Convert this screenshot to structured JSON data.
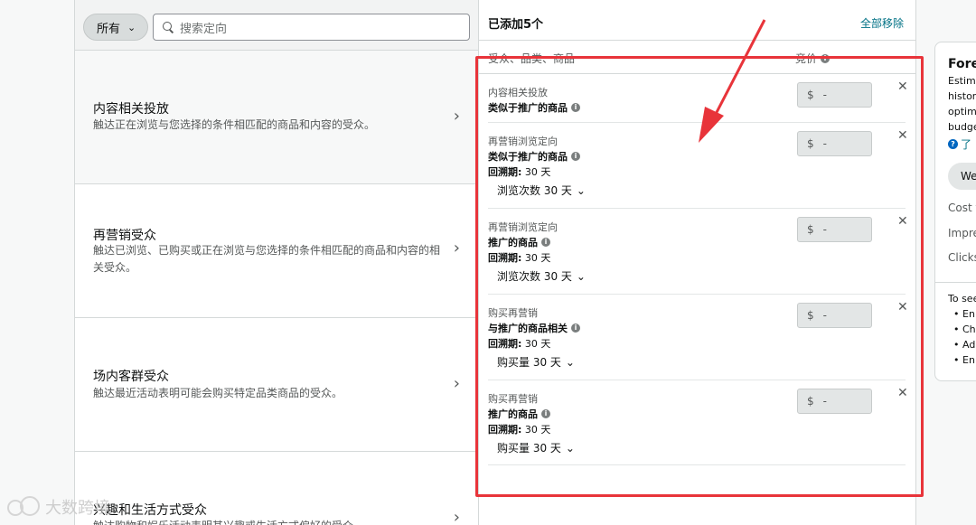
{
  "left": {
    "filter_label": "所有",
    "search_placeholder": "搜索定向",
    "categories": [
      {
        "title": "内容相关投放",
        "desc": "触达正在浏览与您选择的条件相匹配的商品和内容的受众。"
      },
      {
        "title": "再营销受众",
        "desc": "触达已浏览、已购买或正在浏览与您选择的条件相匹配的商品和内容的相关受众。"
      },
      {
        "title": "场内客群受众",
        "desc": "触达最近活动表明可能会购买特定品类商品的受众。"
      },
      {
        "title": "兴趣和生活方式受众",
        "desc": "触达购物和娱乐活动表明其兴趣或生活方式偏好的受众。"
      }
    ]
  },
  "center": {
    "added_title": "已添加5个",
    "remove_all": "全部移除",
    "col_targeting": "受众、品类、商品",
    "col_bid": "竞价",
    "currency": "$",
    "bid_placeholder": "-",
    "lookback_label": "回溯期:",
    "rows": [
      {
        "type": "内容相关投放",
        "target": "类似于推广的商品",
        "lookback": "",
        "dropdown": ""
      },
      {
        "type": "再营销浏览定向",
        "target": "类似于推广的商品",
        "lookback": "30 天",
        "dropdown": "浏览次数 30 天"
      },
      {
        "type": "再营销浏览定向",
        "target": "推广的商品",
        "lookback": "30 天",
        "dropdown": "浏览次数 30 天"
      },
      {
        "type": "购买再营销",
        "target": "与推广的商品相关",
        "lookback": "30 天",
        "dropdown": "购买量 30 天"
      },
      {
        "type": "购买再营销",
        "target": "推广的商品",
        "lookback": "30 天",
        "dropdown": "购买量 30 天"
      }
    ]
  },
  "right": {
    "title": "Fore",
    "est_lines": [
      "Estima",
      "histor",
      "optim",
      "budge"
    ],
    "learn": "了",
    "pill": "We",
    "metrics": [
      "Cost t",
      "Impre",
      "Clicks"
    ],
    "to_see": "To see",
    "bullets": [
      "En",
      "Ch",
      "Ad",
      "En"
    ]
  },
  "watermark": "大数跨境",
  "colors": {
    "accent_link": "#007185",
    "annotation_red": "#e8343a"
  }
}
